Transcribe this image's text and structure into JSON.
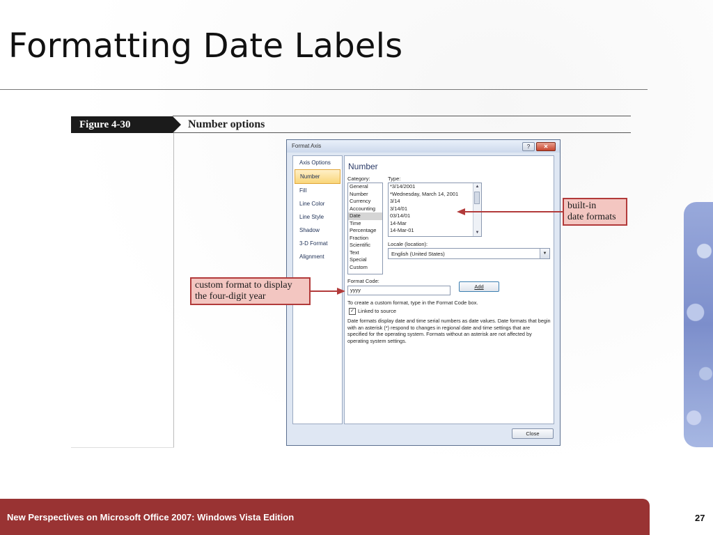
{
  "slide": {
    "title": "Formatting Date Labels",
    "page_number": "27",
    "footer": "New Perspectives on Microsoft Office 2007: Windows Vista Edition"
  },
  "figure": {
    "label": "Figure  4-30",
    "title": "Number options"
  },
  "dialog": {
    "title": "Format Axis",
    "help_label": "?",
    "close_label": "✕",
    "nav_items": [
      {
        "label": "Axis Options"
      },
      {
        "label": "Number"
      },
      {
        "label": "Fill"
      },
      {
        "label": "Line Color"
      },
      {
        "label": "Line Style"
      },
      {
        "label": "Shadow"
      },
      {
        "label": "3-D Format"
      },
      {
        "label": "Alignment"
      }
    ],
    "selected_nav": "Number",
    "panel_heading": "Number",
    "category_label": "Category:",
    "categories": [
      "General",
      "Number",
      "Currency",
      "Accounting",
      "Date",
      "Time",
      "Percentage",
      "Fraction",
      "Scientific",
      "Text",
      "Special",
      "Custom"
    ],
    "selected_category": "Date",
    "type_label": "Type:",
    "types": [
      "*3/14/2001",
      "*Wednesday, March 14, 2001",
      "3/14",
      "3/14/01",
      "03/14/01",
      "14-Mar",
      "14-Mar-01"
    ],
    "locale_label": "Locale (location):",
    "locale_value": "English (United States)",
    "format_code_label": "Format Code:",
    "format_code_value": "yyyy",
    "add_button": "Add",
    "hint": "To create a custom format, type in the Format Code box.",
    "linked_to_source": "Linked to source",
    "linked_checked": true,
    "description": "Date formats display date and time serial numbers as date values.  Date formats that begin with an asterisk (*) respond to changes in regional date and time settings that are specified for the operating system. Formats without an asterisk are not affected by operating system settings.",
    "close_button": "Close"
  },
  "callouts": {
    "builtin": "built-in\ndate formats",
    "custom": "custom format to display\nthe four-digit year"
  },
  "colors": {
    "footer_bg": "#993333",
    "callout_bg": "#f3c6c1",
    "callout_border": "#b23a3a",
    "figure_label_bg": "#1b1b1b"
  }
}
